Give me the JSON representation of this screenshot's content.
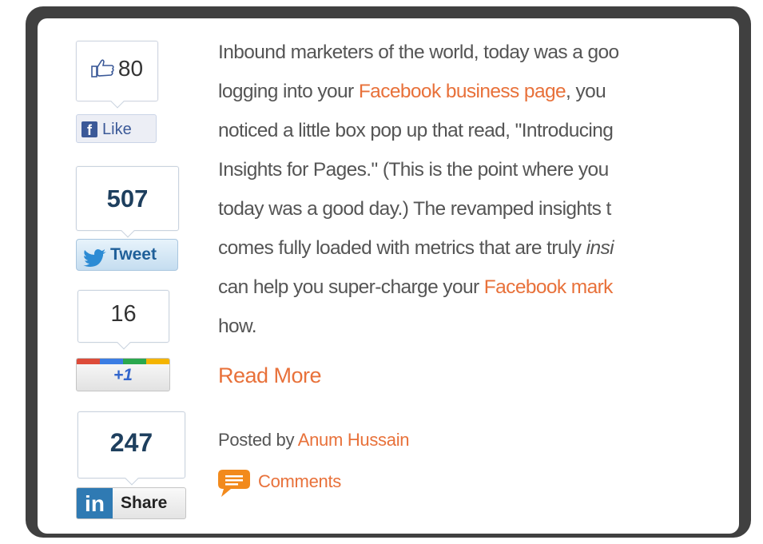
{
  "share_bar": {
    "facebook": {
      "count": "80",
      "button_label": "Like",
      "icon": "thumbs-up-icon"
    },
    "twitter": {
      "count": "507",
      "button_label": "Tweet",
      "icon": "twitter-bird-icon"
    },
    "google_plus": {
      "count": "16",
      "button_label": "+1"
    },
    "linkedin": {
      "count": "247",
      "button_label": "Share",
      "logo_text": "in"
    }
  },
  "article": {
    "line1": "Inbound marketers of the world, today was a goo",
    "line2_pre": "logging into your ",
    "line2_link": "Facebook business page",
    "line2_post": ", you",
    "line3": "noticed a little box pop up that read, \"Introducing",
    "line4": "Insights for Pages.\" (This is the point where you",
    "line5": "today was a good day.) The revamped insights t",
    "line6_pre": "comes fully loaded with metrics that are truly ",
    "line6_ital": "insi",
    "line7_pre": "can help you super-charge your ",
    "line7_link": "Facebook mark",
    "line8": "how."
  },
  "read_more": "Read More",
  "posted": {
    "prefix": "Posted by ",
    "author": "Anum Hussain"
  },
  "comments": {
    "label": "Comments",
    "icon": "comment-bubble-icon"
  },
  "colors": {
    "link": "#e8713a",
    "frame": "#404040",
    "facebook": "#3b5998",
    "linkedin": "#2f7ab3"
  }
}
